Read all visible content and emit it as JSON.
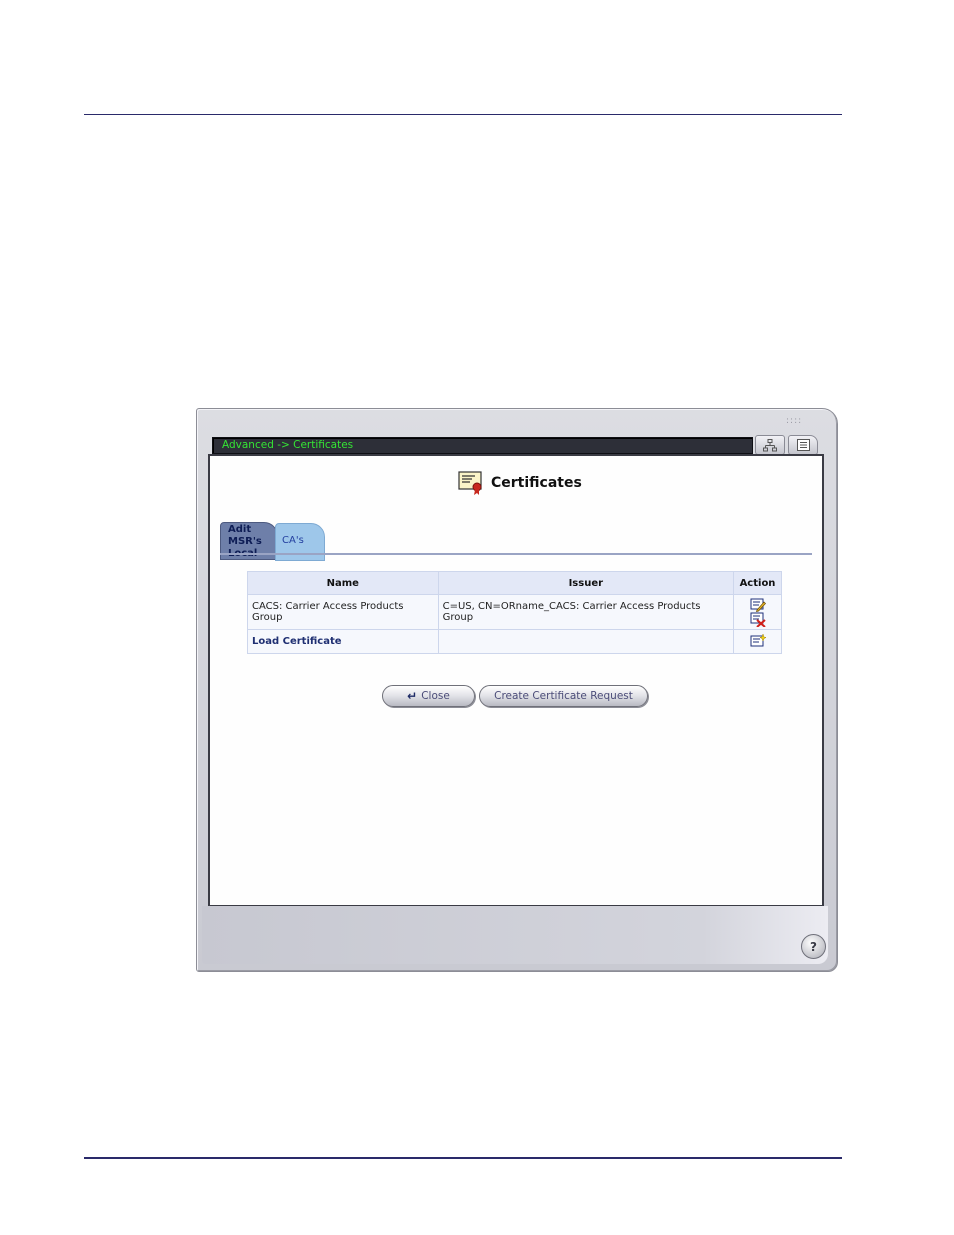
{
  "window": {
    "breadcrumb": "Advanced -> Certificates"
  },
  "page": {
    "title": "Certificates"
  },
  "tabs": [
    {
      "label": "Adit\nMSR's\nLocal"
    },
    {
      "label": "CA's"
    }
  ],
  "table": {
    "headers": [
      "Name",
      "Issuer",
      "Action"
    ],
    "rows": [
      {
        "name": "CACS: Carrier Access Products Group",
        "issuer": "C=US, CN=ORname_CACS: Carrier Access Products Group"
      },
      {
        "name": "Load Certificate",
        "issuer": ""
      }
    ]
  },
  "buttons": {
    "close": "Close",
    "create_request": "Create Certificate Request"
  },
  "icons": {
    "certificate": "certificate-icon",
    "edit": "edit-icon",
    "delete": "delete-icon",
    "load": "load-certificate-icon",
    "help": "help-icon",
    "network_map": "network-map-icon",
    "list_view": "list-view-icon"
  },
  "help_symbol": "?"
}
